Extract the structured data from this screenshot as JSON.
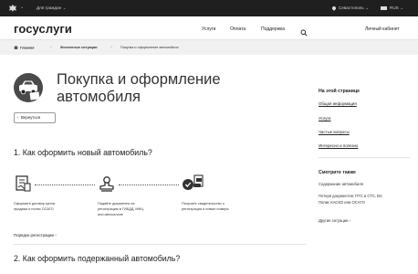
{
  "topbar": {
    "section": "Для граждан",
    "location": "Севастополь",
    "language": "RUS"
  },
  "header": {
    "logo": "госуслуги",
    "nav": [
      "Услуги",
      "Оплата",
      "Поддержка"
    ],
    "cabinet": "Личный кабинет"
  },
  "breadcrumbs": [
    "Главная",
    "Жизненные ситуации",
    "Покупка и оформление автомобиля"
  ],
  "page": {
    "title_line1": "Покупка и оформление",
    "title_line2": "автомобиля",
    "back": "Вернуться"
  },
  "section1": {
    "heading": "1. Как оформить новый автомобиль?",
    "steps": [
      {
        "line1": "Оформите договор купли-",
        "line2": "продажи и полис ОСАГО",
        "line3": "",
        "icon": "contract-icon"
      },
      {
        "line1": "Подайте документы на",
        "line2": "регистрацию в ГИБДД, МФЦ",
        "line3": "или автосалоне",
        "icon": "stamp-icon"
      },
      {
        "line1": "Получите свидетельство о",
        "line2": "регистрации и новые номера",
        "line3": "",
        "icon": "car-document-icon"
      }
    ],
    "link": "Порядок регистрации"
  },
  "section2": {
    "heading": "2. Как оформить подержанный автомобиль?"
  },
  "sidebar": {
    "on_page_title": "На этой странице",
    "links": [
      "Общая информация",
      "Услуги",
      "Частые вопросы",
      "Интересно и полезно"
    ],
    "see_also_title": "Смотрите также",
    "see_also_1": "Содержание автомобиля",
    "see_also_2_line1": "Потеря документов: ПТС и СТС, ВУ,",
    "see_also_2_line2": "Полис КАСКО или ОСАГО",
    "other": "Другие ситуации"
  },
  "colors": {
    "topbar": "#1f1f1f",
    "breadcrumb_bg": "#f1f1f1",
    "text": "#222222"
  }
}
